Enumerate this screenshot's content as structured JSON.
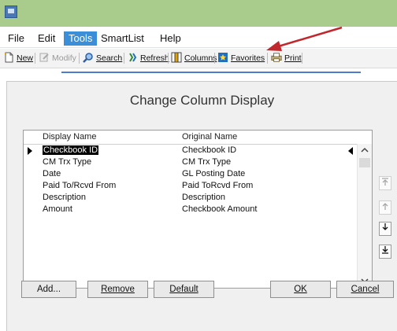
{
  "menu": {
    "items": [
      "File",
      "Edit",
      "Tools",
      "SmartList",
      "Help"
    ]
  },
  "toolbar": {
    "new": "New",
    "modify": "Modify",
    "search": "Search",
    "refresh": "Refresh",
    "columns": "Columns",
    "favorites": "Favorites",
    "print": "Print"
  },
  "dialog": {
    "title": "Change Column Display",
    "headers": {
      "display": "Display Name",
      "original": "Original Name"
    },
    "rows": [
      {
        "display": "Checkbook ID",
        "original": "Checkbook ID"
      },
      {
        "display": "CM Trx Type",
        "original": "CM Trx Type"
      },
      {
        "display": "Date",
        "original": "GL Posting Date"
      },
      {
        "display": "Paid To/Rcvd From",
        "original": "Paid ToRcvd From"
      },
      {
        "display": "Description",
        "original": "Description"
      },
      {
        "display": "Amount",
        "original": "Checkbook Amount"
      }
    ],
    "buttons": {
      "add": "Add...",
      "remove": "Remove",
      "default": "Default",
      "ok": "OK",
      "cancel": "Cancel"
    }
  },
  "colors": {
    "accent": "#3b8fd9",
    "titlebar": "#a9cc8c",
    "annotation_arrow": "#c0282d"
  }
}
